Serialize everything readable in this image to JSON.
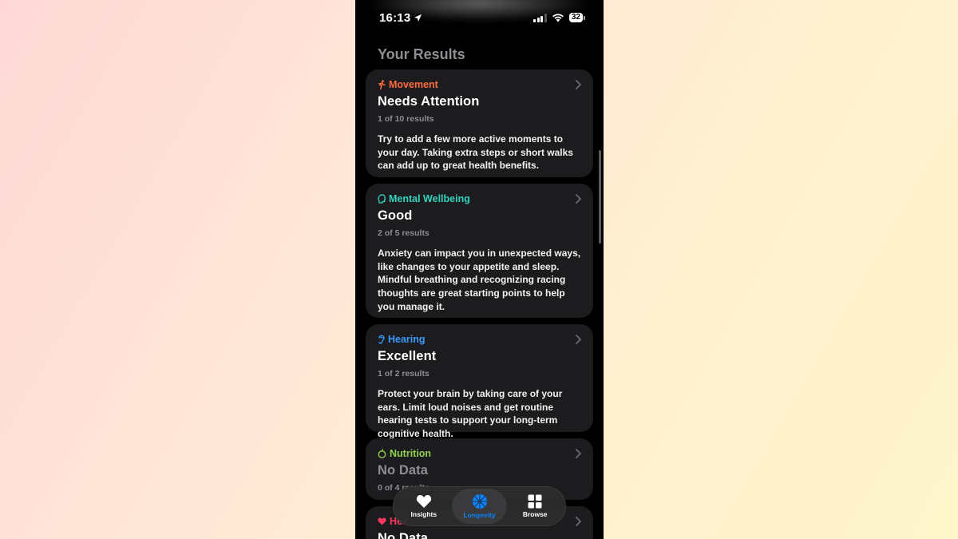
{
  "status_bar": {
    "time": "16:13",
    "battery": "32"
  },
  "section_title": "Your Results",
  "cards": [
    {
      "category": "Movement",
      "status": "Needs Attention",
      "count": "1 of 10 results",
      "text": "Try to add a few more active moments to your day. Taking extra steps or short walks can add up to great health benefits.",
      "color": "#ff6b3d",
      "icon": "figure-run-icon"
    },
    {
      "category": "Mental Wellbeing",
      "status": "Good",
      "count": "2 of 5 results",
      "text": "Anxiety can impact you in unexpected ways, like changes to your appetite and sleep. Mindful breathing and recognizing racing thoughts are great starting points to help you manage it.",
      "color": "#34d3c0",
      "icon": "head-profile-icon"
    },
    {
      "category": "Hearing",
      "status": "Excellent",
      "count": "1 of 2 results",
      "text": "Protect your brain by taking care of your ears. Limit loud noises and get routine hearing tests to support your long-term cognitive health.",
      "color": "#3b9bff",
      "icon": "ear-icon"
    },
    {
      "category": "Nutrition",
      "status": "No Data",
      "count": "0 of 4 results",
      "color": "#8fd14f",
      "icon": "apple-icon"
    },
    {
      "category": "Hea",
      "status": "No Data",
      "color": "#ff375f",
      "icon": "heart-icon"
    }
  ],
  "tabs": [
    {
      "label": "Insights",
      "icon": "heart-icon",
      "active": false
    },
    {
      "label": "Longevity",
      "icon": "longevity-icon",
      "active": true
    },
    {
      "label": "Browse",
      "icon": "grid-icon",
      "active": false
    }
  ],
  "colors": {
    "accent": "#0a84ff",
    "card_bg": "#1c1c1e",
    "secondary_text": "#8e8e93"
  }
}
